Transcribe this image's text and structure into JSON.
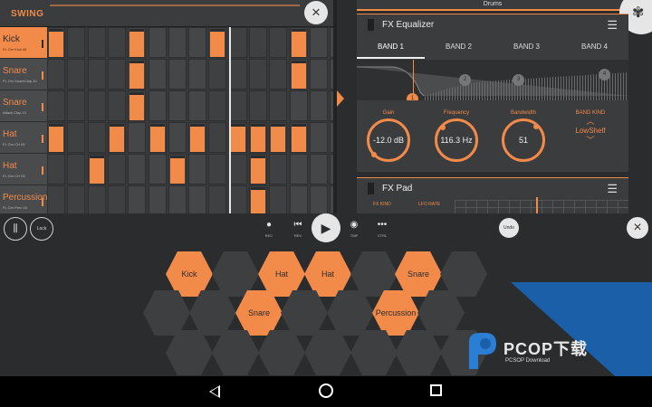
{
  "sequencer": {
    "swing_label": "SWING",
    "channels": [
      {
        "name": "Kick",
        "sub": "FL Grv Kick 46",
        "selected": true
      },
      {
        "name": "Snare",
        "sub": "FL Grv SnareClap 20",
        "selected": false
      },
      {
        "name": "Snare",
        "sub": "Attack Clap 10",
        "selected": false
      },
      {
        "name": "Hat",
        "sub": "FL Grv CH 09",
        "selected": false
      },
      {
        "name": "Hat",
        "sub": "FL Grv CH 03",
        "selected": false
      },
      {
        "name": "Percussion",
        "sub": "FL Grv Perc 04",
        "selected": false
      }
    ],
    "steps": [
      [
        0,
        4,
        8,
        12
      ],
      [
        4,
        12
      ],
      [
        4
      ],
      [
        0,
        3,
        5,
        7,
        9,
        10,
        11,
        12
      ],
      [
        2,
        6,
        10
      ],
      [
        10
      ]
    ]
  },
  "header": {
    "pattern_title": "Drums"
  },
  "fx_equalizer": {
    "title": "FX Equalizer",
    "bands": [
      "BAND 1",
      "BAND 2",
      "BAND 3",
      "BAND 4"
    ],
    "active_band": 0,
    "nodes": [
      "1",
      "2",
      "3",
      "4"
    ],
    "knobs": {
      "gain_label": "Gain",
      "gain_value": "-12.0 dB",
      "freq_label": "Frequency",
      "freq_value": "116.3 Hz",
      "bw_label": "Bandwidth",
      "bw_value": "51",
      "kind_label": "BAND KIND",
      "kind_value": "LowShelf"
    }
  },
  "fx_pad": {
    "title": "FX Pad",
    "label_kind": "FX KIND",
    "label_lfo": "LFO RATE"
  },
  "transport": {
    "lock_label": "Lock",
    "rec_label": "REC",
    "rev_label": "REV",
    "tmp_label": "TMP",
    "ctrl_label": "CTRL",
    "undo_label": "Undo"
  },
  "pads": {
    "labels": [
      "Kick",
      "Hat",
      "Hat",
      "Snare",
      "Snare",
      "Percussion"
    ]
  },
  "watermark": {
    "text": "PCOP下载",
    "sub": "PCSOP Download"
  },
  "colors": {
    "accent": "#f28a4a",
    "background": "#2b2c2e",
    "watermark": "#1a5fa8"
  }
}
